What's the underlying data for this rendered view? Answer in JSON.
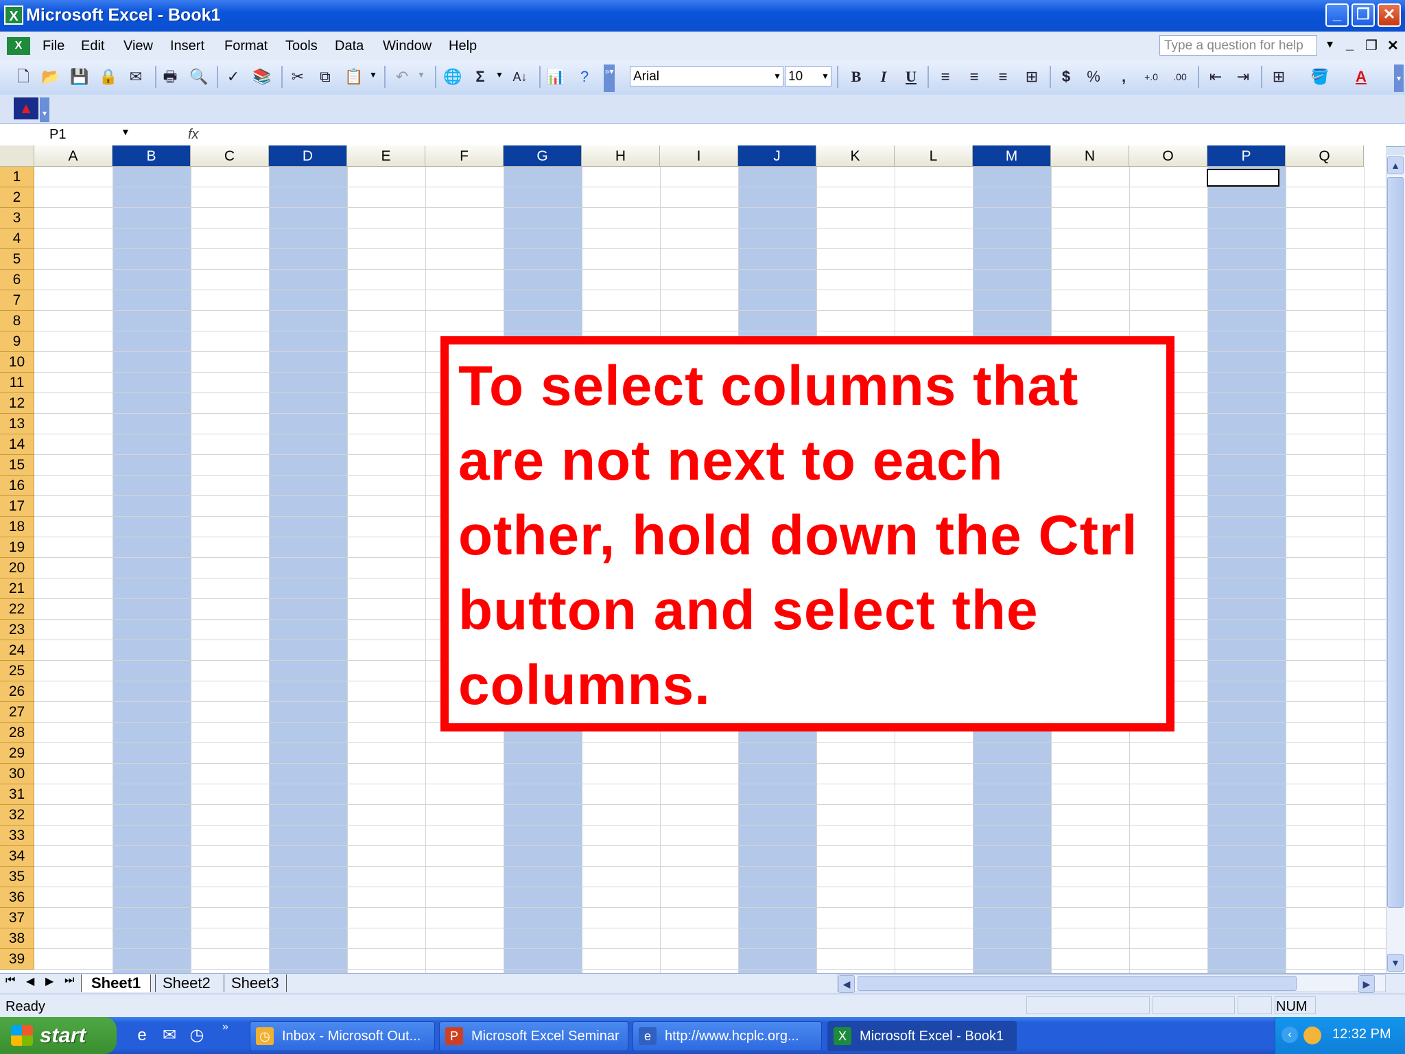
{
  "window": {
    "title": "Microsoft Excel - Book1",
    "app_icon": "excel-icon",
    "minimize": "_",
    "maximize": "❐",
    "close": "✕"
  },
  "menu": [
    "File",
    "Edit",
    "View",
    "Insert",
    "Format",
    "Tools",
    "Data",
    "Window",
    "Help"
  ],
  "help_box_placeholder": "Type a question for help",
  "toolbar": {
    "font": "Arial",
    "size": "10",
    "bold": "B",
    "italic": "I",
    "underline": "U",
    "currency": "$",
    "percent": "%",
    "comma": ",",
    "sum": "Σ"
  },
  "formula_bar": {
    "name_box": "P1",
    "fx": "fx",
    "content": ""
  },
  "columns": [
    "A",
    "B",
    "C",
    "D",
    "E",
    "F",
    "G",
    "H",
    "I",
    "J",
    "K",
    "L",
    "M",
    "N",
    "O",
    "P",
    "Q"
  ],
  "selected_columns": [
    "B",
    "D",
    "G",
    "J",
    "M",
    "P"
  ],
  "rows": [
    "1",
    "2",
    "3",
    "4",
    "5",
    "6",
    "7",
    "8",
    "9",
    "10",
    "11",
    "12",
    "13",
    "14",
    "15",
    "16",
    "17",
    "18",
    "19",
    "20",
    "21",
    "22",
    "23",
    "24",
    "25",
    "26",
    "27",
    "28",
    "29",
    "30",
    "31",
    "32",
    "33",
    "34",
    "35",
    "36",
    "37",
    "38",
    "39"
  ],
  "active_cell": "P1",
  "callout": {
    "text": "To select columns that are not next to each other, hold down the Ctrl button and select the columns.",
    "color": "#ff0000"
  },
  "sheets": [
    "Sheet1",
    "Sheet2",
    "Sheet3"
  ],
  "active_sheet": "Sheet1",
  "status": {
    "ready": "Ready",
    "num": "NUM"
  },
  "taskbar": {
    "start": "start",
    "tasks": [
      {
        "label": "Inbox - Microsoft Out...",
        "icon": "outlook-icon"
      },
      {
        "label": "Microsoft Excel Seminar",
        "icon": "powerpoint-icon"
      },
      {
        "label": "http://www.hcplc.org...",
        "icon": "ie-icon"
      },
      {
        "label": "Microsoft Excel - Book1",
        "icon": "excel-icon",
        "active": true
      }
    ],
    "clock": "12:32 PM"
  },
  "colors": {
    "selected_column_fill": "#b4c9e9",
    "selected_header": "#0b3f9f",
    "row_header": "#f5c56a"
  }
}
